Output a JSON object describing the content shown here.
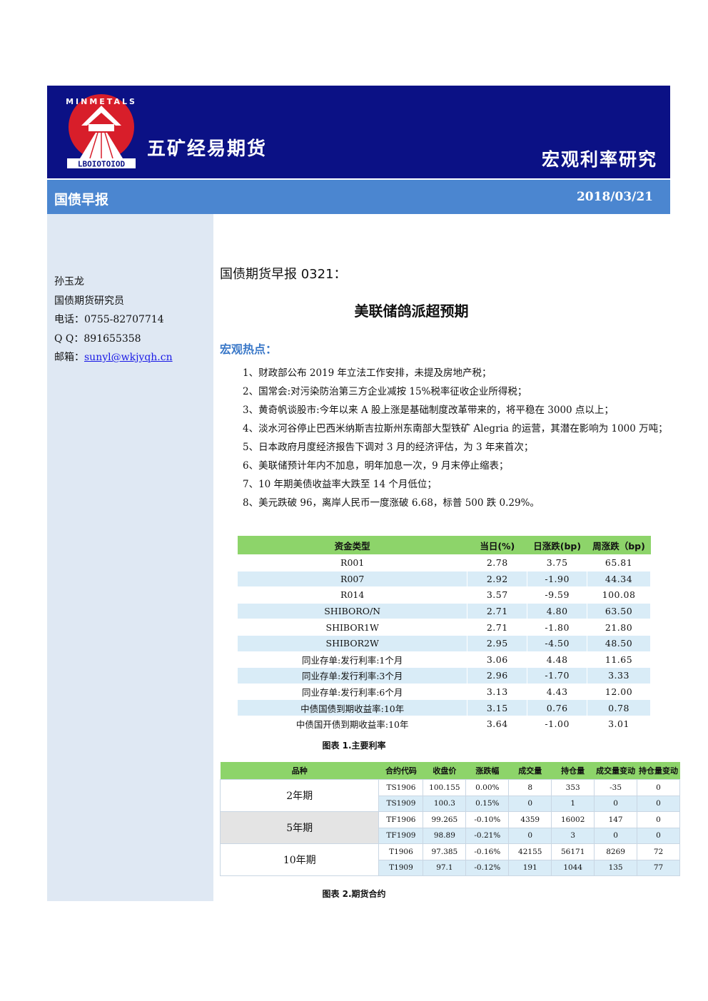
{
  "header": {
    "logo_text": "MINMETALS",
    "company": "五矿经易期货",
    "section": "宏观利率研究",
    "report_type": "国债早报",
    "date": "2018/03/21"
  },
  "author": {
    "name": "孙玉龙",
    "title": "国债期货研究员",
    "phone": "电话：0755-82707714",
    "qq": "Q Q：891655358",
    "email_label": "邮箱：",
    "email": "sunyl@wkjyqh.cn"
  },
  "doc": {
    "title": "国债期货早报 0321：",
    "headline": "美联储鸽派超预期",
    "hot_title": "宏观热点：",
    "news": [
      "1、财政部公布 2019 年立法工作安排，未提及房地产税；",
      "2、国常会:对污染防治第三方企业减按 15%税率征收企业所得税；",
      "3、黄奇帆谈股市:今年以来 A 股上涨是基础制度改革带来的，将平稳在 3000 点以上；",
      "4、淡水河谷停止巴西米纳斯吉拉斯州东南部大型铁矿 Alegria 的运营，其潜在影响为 1000 万吨；",
      "5、日本政府月度经济报告下调对 3 月的经济评估，为 3 年来首次；",
      "6、美联储预计年内不加息，明年加息一次，9 月末停止缩表；",
      "7、10 年期美债收益率大跌至 14 个月低位；",
      "8、美元跌破 96，离岸人民币一度涨破 6.68，标普 500 跌 0.29%。"
    ]
  },
  "rates_table": {
    "headers": [
      "资金类型",
      "当日(%)",
      "日涨跌(bp)",
      "周涨跌（bp)"
    ],
    "rows": [
      [
        "R001",
        "2.78",
        "3.75",
        "65.81"
      ],
      [
        "R007",
        "2.92",
        "-1.90",
        "44.34"
      ],
      [
        "R014",
        "3.57",
        "-9.59",
        "100.08"
      ],
      [
        "SHIBORO/N",
        "2.71",
        "4.80",
        "63.50"
      ],
      [
        "SHIBOR1W",
        "2.71",
        "-1.80",
        "21.80"
      ],
      [
        "SHIBOR2W",
        "2.95",
        "-4.50",
        "48.50"
      ],
      [
        "同业存单:发行利率:1个月",
        "3.06",
        "4.48",
        "11.65"
      ],
      [
        "同业存单:发行利率:3个月",
        "2.96",
        "-1.70",
        "3.33"
      ],
      [
        "同业存单:发行利率:6个月",
        "3.13",
        "4.43",
        "12.00"
      ],
      [
        "中债国债到期收益率:10年",
        "3.15",
        "0.76",
        "0.78"
      ],
      [
        "中债国开债到期收益率:10年",
        "3.64",
        "-1.00",
        "3.01"
      ]
    ],
    "caption": "图表 1.主要利率"
  },
  "futures_table": {
    "headers": [
      "品种",
      "合约代码",
      "收盘价",
      "涨跌幅",
      "成交量",
      "持仓量",
      "成交量变动",
      "持仓量变动"
    ],
    "groups": [
      {
        "name": "2年期",
        "rows": [
          [
            "TS1906",
            "100.155",
            "0.00%",
            "8",
            "353",
            "-35",
            "0"
          ],
          [
            "TS1909",
            "100.3",
            "0.15%",
            "0",
            "1",
            "0",
            "0"
          ]
        ]
      },
      {
        "name": "5年期",
        "rows": [
          [
            "TF1906",
            "99.265",
            "-0.10%",
            "4359",
            "16002",
            "147",
            "0"
          ],
          [
            "TF1909",
            "98.89",
            "-0.21%",
            "0",
            "3",
            "0",
            "0"
          ]
        ]
      },
      {
        "name": "10年期",
        "rows": [
          [
            "T1906",
            "97.385",
            "-0.16%",
            "42155",
            "56171",
            "8269",
            "72"
          ],
          [
            "T1909",
            "97.1",
            "-0.12%",
            "191",
            "1044",
            "135",
            "77"
          ]
        ]
      }
    ],
    "caption": "图表 2.期货合约"
  },
  "colors": {
    "header_bg": "#0b1185",
    "subbar_bg": "#4b86d0",
    "sidebar_bg": "#dfe8f3",
    "table_header": "#8dd46a",
    "row_alt": "#d9ecf7",
    "accent_title": "#3a78c8",
    "logo_red": "#d81e2a"
  }
}
